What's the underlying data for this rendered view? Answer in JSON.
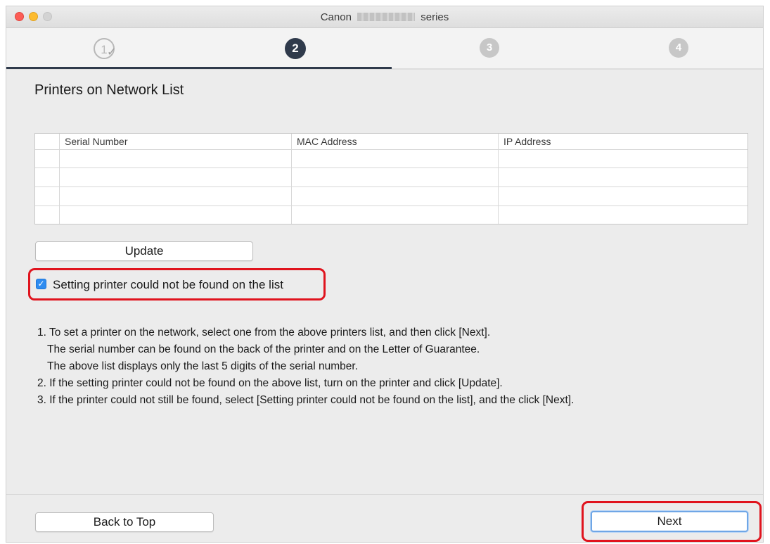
{
  "window": {
    "title_left": "Canon",
    "title_right": "series"
  },
  "steps": [
    {
      "number": "1",
      "state": "completed"
    },
    {
      "number": "2",
      "state": "current"
    },
    {
      "number": "3",
      "state": "pending"
    },
    {
      "number": "4",
      "state": "pending"
    }
  ],
  "page": {
    "heading": "Printers on Network List"
  },
  "table": {
    "headers": [
      "Serial Number",
      "MAC Address",
      "IP Address"
    ],
    "rows": []
  },
  "buttons": {
    "update": "Update",
    "back_to_top": "Back to Top",
    "next": "Next"
  },
  "checkbox": {
    "label": "Setting printer could not be found on the list",
    "checked": true
  },
  "instructions": [
    "1. To set a printer on the network, select one from the above printers list, and then click [Next].",
    "The serial number can be found on the back of the printer and on the Letter of Guarantee.",
    "The above list displays only the last 5 digits of the serial number.",
    "2. If the setting printer could not be found on the above list, turn on the printer and click [Update].",
    "3. If the printer could not still be found, select [Setting printer could not be found on the list], and the click [Next]."
  ],
  "colors": {
    "accent": "#2f3a4b",
    "highlight": "#e0141e",
    "checkbox": "#2f8cf0"
  }
}
